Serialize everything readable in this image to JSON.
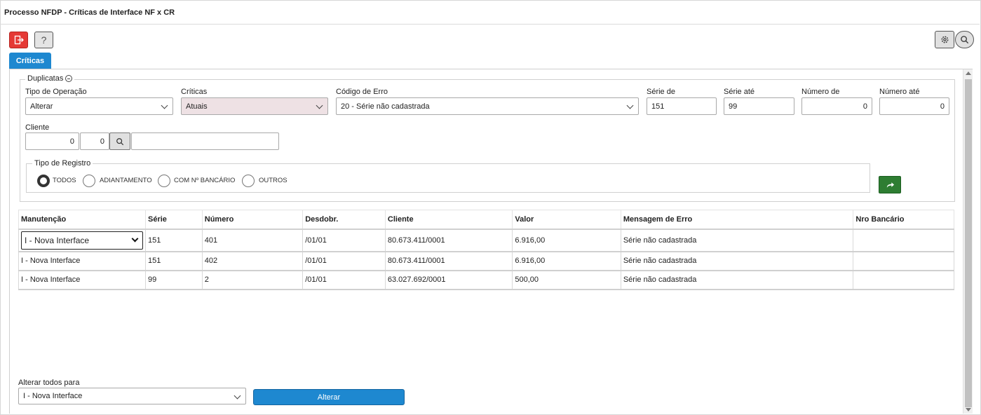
{
  "window": {
    "title": "Processo NFDP - Críticas de Interface NF x CR"
  },
  "toolbar": {
    "help_label": "?"
  },
  "tabs": [
    {
      "label": "Críticas"
    }
  ],
  "filters": {
    "legend": "Duplicatas",
    "tipo_operacao": {
      "label": "Tipo de Operação",
      "value": "Alterar"
    },
    "criticas": {
      "label": "Críticas",
      "value": "Atuais"
    },
    "codigo_erro": {
      "label": "Código de Erro",
      "value": "20 - Série não cadastrada"
    },
    "serie_de": {
      "label": "Série de",
      "value": "151"
    },
    "serie_ate": {
      "label": "Série até",
      "value": "99"
    },
    "numero_de": {
      "label": "Número de",
      "value": "0"
    },
    "numero_ate": {
      "label": "Número até",
      "value": "0"
    },
    "cliente": {
      "label": "Cliente",
      "value1": "0",
      "value2": "0",
      "name": ""
    }
  },
  "tipo_registro": {
    "legend": "Tipo de Registro",
    "options": [
      "TODOS",
      "ADIANTAMENTO",
      "COM Nº BANCÁRIO",
      "OUTROS"
    ],
    "selected": "TODOS"
  },
  "table": {
    "columns": [
      "Manutenção",
      "Série",
      "Número",
      "Desdobr.",
      "Cliente",
      "Valor",
      "Mensagem de Erro",
      "Nro Bancário"
    ],
    "rows": [
      [
        "I - Nova Interface",
        "151",
        "401",
        "/01/01",
        "80.673.411/0001",
        "6.916,00",
        "Série não cadastrada",
        ""
      ],
      [
        "I - Nova Interface",
        "151",
        "402",
        "/01/01",
        "80.673.411/0001",
        "6.916,00",
        "Série não cadastrada",
        ""
      ],
      [
        "I - Nova Interface",
        "99",
        "2",
        "/01/01",
        "63.027.692/0001",
        "500,00",
        "Série não cadastrada",
        ""
      ]
    ]
  },
  "footer": {
    "alterar_todos_label": "Alterar todos para",
    "alterar_todos_value": "I - Nova Interface",
    "alterar_button": "Alterar"
  },
  "colors": {
    "exit_red": "#e53935",
    "primary_blue": "#1e88d0",
    "go_green": "#2e7d32"
  },
  "icons": [
    "exit-icon",
    "help-icon",
    "gear-icon",
    "search-icon",
    "minus-circle-icon",
    "forward-arrow-icon",
    "chevron-down-icon"
  ]
}
